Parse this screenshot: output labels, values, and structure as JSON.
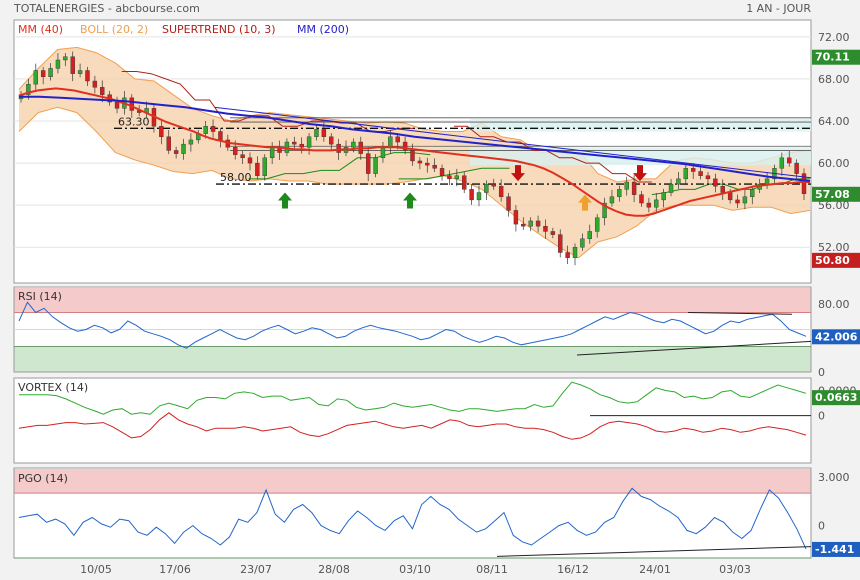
{
  "header": {
    "title": "TOTALENERGIES - abcbourse.com",
    "period": "1 AN - JOUR"
  },
  "colors": {
    "price_up": "#2eaa2e",
    "price_down": "#d42020",
    "mm40": "#e0301e",
    "mm200": "#2222cc",
    "boll_fill": "#f5cfa6",
    "boll_line": "#f0a050",
    "supertrend": "#b0201a",
    "supertrend_up": "#1a8a1a",
    "rsi": "#2266cc",
    "vortex_plus": "#2eaa2e",
    "vortex_minus": "#d42020",
    "pgo": "#2266cc",
    "zone_high": "#f4caca",
    "zone_low": "#cfe6cf",
    "tag_green": "#2e8b2e",
    "tag_red": "#c41e1e",
    "tag_blue": "#1f5fbf"
  },
  "chart_data": [
    {
      "type": "line",
      "name": "price",
      "legend": [
        "MM (40)",
        "BOLL (20, 2)",
        "SUPERTREND (10, 3)",
        "MM (200)"
      ],
      "x_ticks": [
        "10/05",
        "17/06",
        "23/07",
        "28/08",
        "03/10",
        "08/11",
        "16/12",
        "24/01",
        "03/03"
      ],
      "y_ticks": [
        "72.00",
        "68.00",
        "64.00",
        "60.00",
        "56.00",
        "52.00"
      ],
      "ylim": [
        48.6,
        73.6
      ],
      "levels": [
        {
          "label": "63.30",
          "value": 63.3
        },
        {
          "label": "58.00",
          "value": 58.0
        }
      ],
      "tags": [
        {
          "text": "70.11",
          "value": 70.11,
          "color": "tag_green"
        },
        {
          "text": "57.08",
          "value": 57.08,
          "color": "tag_green"
        },
        {
          "text": "50.80",
          "value": 50.8,
          "color": "tag_red"
        }
      ],
      "close": [
        66.5,
        67.5,
        68.8,
        68.2,
        69.0,
        69.8,
        70.11,
        68.5,
        68.8,
        67.8,
        67.2,
        66.5,
        65.8,
        65.2,
        66.2,
        65.0,
        64.8,
        65.2,
        63.5,
        62.5,
        61.2,
        60.9,
        61.8,
        62.2,
        62.8,
        63.5,
        63.0,
        62.2,
        61.5,
        60.8,
        60.5,
        60.0,
        58.8,
        60.5,
        61.5,
        61.0,
        62.0,
        61.8,
        61.5,
        62.5,
        63.2,
        62.5,
        61.8,
        61.0,
        61.5,
        62.0,
        60.9,
        59.0,
        60.5,
        61.5,
        62.5,
        62.0,
        61.2,
        60.2,
        60.0,
        59.8,
        59.5,
        58.8,
        58.5,
        58.8,
        57.5,
        56.5,
        57.2,
        58.0,
        57.8,
        56.8,
        55.5,
        54.2,
        54.0,
        54.5,
        54.0,
        53.5,
        53.2,
        51.5,
        51.0,
        52.0,
        52.8,
        53.5,
        54.8,
        56.2,
        56.8,
        57.5,
        58.2,
        57.0,
        56.2,
        55.8,
        56.5,
        57.2,
        58.0,
        58.5,
        59.5,
        59.2,
        58.8,
        58.5,
        57.8,
        57.2,
        56.5,
        56.2,
        56.8,
        57.5,
        58.0,
        58.5,
        59.5,
        60.5,
        60.0,
        59.0,
        57.08
      ],
      "mm40": [
        66.4,
        66.7,
        66.9,
        67.0,
        67.1,
        67.0,
        66.9,
        66.7,
        66.5,
        66.3,
        66.1,
        65.8,
        65.5,
        65.1,
        64.7,
        64.3,
        63.9,
        63.6,
        63.3,
        63.0,
        62.6,
        62.3,
        62.1,
        61.9,
        61.8,
        61.7,
        61.6,
        61.5,
        61.5,
        61.4,
        61.3,
        61.3,
        61.2,
        61.2,
        61.2,
        61.3,
        61.3,
        61.4,
        61.4,
        61.5,
        61.5,
        61.5,
        61.4,
        61.3,
        61.2,
        61.1,
        61.0,
        60.9,
        60.8,
        60.7,
        60.6,
        60.5,
        60.4,
        60.3,
        60.2,
        60.0,
        59.8,
        59.5,
        59.1,
        58.6,
        58.1,
        57.5,
        56.9,
        56.3,
        55.8,
        55.4,
        55.1,
        55.0,
        55.0,
        55.2,
        55.5,
        55.8,
        56.1,
        56.4,
        56.6,
        56.8,
        57.0,
        57.2,
        57.4,
        57.6,
        57.8,
        57.9,
        58.0,
        58.1,
        58.1,
        58.2,
        58.2
      ],
      "mm200": [
        66.3,
        66.3,
        66.2,
        66.1,
        66.0,
        65.9,
        65.7,
        65.5,
        65.3,
        65.0,
        64.7,
        64.5,
        64.3,
        64.0,
        63.7,
        63.5,
        63.2,
        63.0,
        62.8,
        62.5,
        62.3,
        62.1,
        61.9,
        61.7,
        61.5,
        61.3,
        61.1,
        60.9,
        60.7,
        60.5,
        60.3,
        60.1,
        59.9,
        59.6,
        59.3,
        59.0,
        58.7,
        58.5,
        58.3
      ],
      "boll_upper": [
        67.0,
        69.0,
        70.8,
        71.0,
        70.5,
        69.5,
        68.0,
        67.8,
        66.5,
        65.2,
        64.5,
        64.0,
        64.5,
        64.8,
        64.6,
        64.4,
        64.2,
        64.0,
        63.8,
        63.9,
        63.8,
        63.2,
        63.0,
        63.0,
        63.8,
        62.5,
        62.2,
        61.0,
        61.0,
        61.2,
        59.0,
        58.2,
        58.5,
        58.5,
        60.2,
        60.5,
        60.3,
        60.0,
        60.0,
        60.5,
        61.0,
        61.2
      ],
      "boll_lower": [
        63.0,
        64.8,
        65.3,
        64.8,
        63.0,
        61.0,
        60.3,
        59.8,
        59.2,
        59.0,
        59.3,
        58.5,
        58.3,
        58.5,
        58.3,
        58.3,
        58.0,
        58.0,
        58.0,
        58.0,
        58.2,
        58.5,
        58.8,
        58.3,
        57.5,
        56.0,
        54.5,
        53.2,
        52.0,
        51.0,
        52.5,
        53.0,
        54.0,
        55.5,
        56.0,
        56.0,
        56.0,
        55.5,
        55.8,
        55.8,
        55.2,
        55.5
      ],
      "supertrend": [
        [
          [
            68.7,
            68.7,
            68.5,
            68.0,
            67.5,
            66.0,
            66.0,
            64.0,
            64.0,
            64.5,
            64.5,
            63.5,
            63.5,
            64.0,
            64.0,
            63.8,
            63.8,
            63.0,
            63.0,
            63.3,
            63.3
          ]
        ],
        [
          [
            58.5,
            58.5,
            59.0,
            59.0,
            59.3,
            59.3,
            60.5,
            60.5,
            61.0,
            61.0,
            60.8
          ]
        ],
        [
          [
            58.5,
            58.5,
            59.0,
            59.5,
            59.5
          ]
        ],
        [
          [
            63.5,
            63.5,
            62.5,
            62.5,
            62.0,
            62.0,
            61.2,
            61.2,
            60.5,
            60.5,
            60.0,
            60.0,
            59.0,
            59.0,
            58.2,
            58.2
          ]
        ],
        [
          [
            57.0,
            57.2,
            57.5,
            57.5,
            58.0,
            58.0,
            57.5,
            57.5,
            58.0,
            58.0,
            58.5,
            58.5
          ]
        ]
      ],
      "arrows": [
        {
          "dir": "up",
          "color": "green"
        },
        {
          "dir": "up",
          "color": "green"
        },
        {
          "dir": "down",
          "color": "red"
        },
        {
          "dir": "up",
          "color": "orange"
        },
        {
          "dir": "down",
          "color": "red"
        }
      ]
    },
    {
      "type": "line",
      "name": "RSI (14)",
      "y_ticks": [
        "80.00",
        "40.00",
        "0"
      ],
      "ylim": [
        0,
        100
      ],
      "zones": [
        70,
        30
      ],
      "tag": {
        "text": "42.006",
        "value": 42.006,
        "color": "tag_blue"
      },
      "values": [
        60,
        82,
        70,
        75,
        65,
        58,
        52,
        48,
        50,
        55,
        52,
        46,
        50,
        60,
        55,
        48,
        45,
        42,
        38,
        32,
        28,
        35,
        40,
        45,
        50,
        45,
        40,
        38,
        42,
        48,
        52,
        55,
        50,
        45,
        48,
        52,
        50,
        45,
        40,
        42,
        48,
        52,
        55,
        52,
        50,
        48,
        45,
        42,
        38,
        40,
        45,
        50,
        48,
        42,
        38,
        35,
        38,
        42,
        40,
        35,
        32,
        34,
        36,
        38,
        40,
        42,
        45,
        50,
        55,
        60,
        65,
        62,
        66,
        70,
        68,
        64,
        60,
        58,
        62,
        60,
        55,
        50,
        45,
        48,
        55,
        60,
        58,
        62,
        64,
        66,
        68,
        60,
        50,
        46,
        42.006
      ]
    },
    {
      "type": "line",
      "name": "VORTEX (14)",
      "y_ticks": [
        "0.0900",
        "0"
      ],
      "ylim": [
        -0.17,
        0.135
      ],
      "tag": {
        "text": "0.0663",
        "value": 0.0663,
        "color": "tag_green"
      },
      "series": [
        {
          "name": "VI+",
          "values": [
            0.075,
            0.075,
            0.075,
            0.075,
            0.072,
            0.06,
            0.045,
            0.03,
            0.018,
            0.005,
            0.02,
            0.025,
            0.005,
            0.01,
            0.005,
            0.035,
            0.045,
            0.035,
            0.025,
            0.055,
            0.065,
            0.065,
            0.06,
            0.08,
            0.085,
            0.08,
            0.065,
            0.07,
            0.07,
            0.055,
            0.06,
            0.065,
            0.04,
            0.035,
            0.06,
            0.055,
            0.03,
            0.02,
            0.025,
            0.03,
            0.045,
            0.035,
            0.03,
            0.035,
            0.04,
            0.03,
            0.02,
            0.015,
            0.025,
            0.025,
            0.02,
            0.015,
            0.02,
            0.025,
            0.025,
            0.04,
            0.03,
            0.035,
            0.08,
            0.12,
            0.11,
            0.095,
            0.075,
            0.065,
            0.05,
            0.045,
            0.05,
            0.075,
            0.1,
            0.09,
            0.085,
            0.065,
            0.07,
            0.06,
            0.065,
            0.085,
            0.09,
            0.07,
            0.065,
            0.08,
            0.095,
            0.11,
            0.1,
            0.09,
            0.08
          ]
        },
        {
          "name": "VI-",
          "values": [
            -0.045,
            -0.04,
            -0.035,
            -0.035,
            -0.03,
            -0.025,
            -0.025,
            -0.03,
            -0.028,
            -0.025,
            -0.04,
            -0.06,
            -0.08,
            -0.075,
            -0.05,
            -0.015,
            0.01,
            -0.015,
            -0.03,
            -0.04,
            -0.055,
            -0.045,
            -0.045,
            -0.045,
            -0.04,
            -0.045,
            -0.055,
            -0.05,
            -0.045,
            -0.04,
            -0.06,
            -0.07,
            -0.075,
            -0.065,
            -0.05,
            -0.035,
            -0.03,
            -0.025,
            -0.02,
            -0.03,
            -0.04,
            -0.045,
            -0.04,
            -0.035,
            -0.045,
            -0.03,
            -0.015,
            -0.02,
            -0.035,
            -0.04,
            -0.035,
            -0.03,
            -0.03,
            -0.04,
            -0.045,
            -0.045,
            -0.05,
            -0.06,
            -0.075,
            -0.085,
            -0.08,
            -0.065,
            -0.04,
            -0.025,
            -0.02,
            -0.025,
            -0.03,
            -0.04,
            -0.055,
            -0.06,
            -0.055,
            -0.045,
            -0.05,
            -0.06,
            -0.055,
            -0.045,
            -0.05,
            -0.06,
            -0.055,
            -0.045,
            -0.04,
            -0.045,
            -0.05,
            -0.06,
            -0.07
          ]
        }
      ]
    },
    {
      "type": "line",
      "name": "PGO (14)",
      "y_ticks": [
        "3.000",
        "0"
      ],
      "ylim": [
        -2.0,
        3.55
      ],
      "zones": [
        2.0,
        -2.0
      ],
      "tag": {
        "text": "-1.441",
        "value": -1.441,
        "color": "tag_blue"
      },
      "values": [
        0.5,
        0.6,
        0.7,
        0.2,
        0.4,
        0.1,
        -0.6,
        0.2,
        0.5,
        0.1,
        -0.1,
        0.4,
        0.3,
        -0.4,
        -0.6,
        -0.1,
        -0.5,
        -1.1,
        -0.4,
        0.0,
        -0.5,
        -0.8,
        -1.2,
        -0.7,
        0.4,
        0.2,
        0.8,
        2.2,
        0.7,
        0.2,
        1.0,
        1.3,
        0.8,
        0.0,
        -0.3,
        -0.5,
        0.3,
        0.9,
        0.5,
        0.0,
        -0.3,
        0.3,
        0.6,
        -0.2,
        1.3,
        1.8,
        1.3,
        1.0,
        0.4,
        0.0,
        -0.4,
        -0.2,
        0.3,
        0.8,
        -0.6,
        -1.0,
        -1.2,
        -0.8,
        -0.4,
        0.0,
        0.2,
        -0.3,
        -0.6,
        -0.4,
        0.2,
        0.5,
        1.5,
        2.3,
        1.8,
        1.6,
        1.2,
        0.9,
        0.5,
        -0.3,
        -0.5,
        -0.1,
        0.5,
        0.2,
        -0.4,
        -0.8,
        -0.3,
        1.0,
        2.2,
        1.7,
        0.8,
        -0.2,
        -1.441
      ]
    }
  ]
}
